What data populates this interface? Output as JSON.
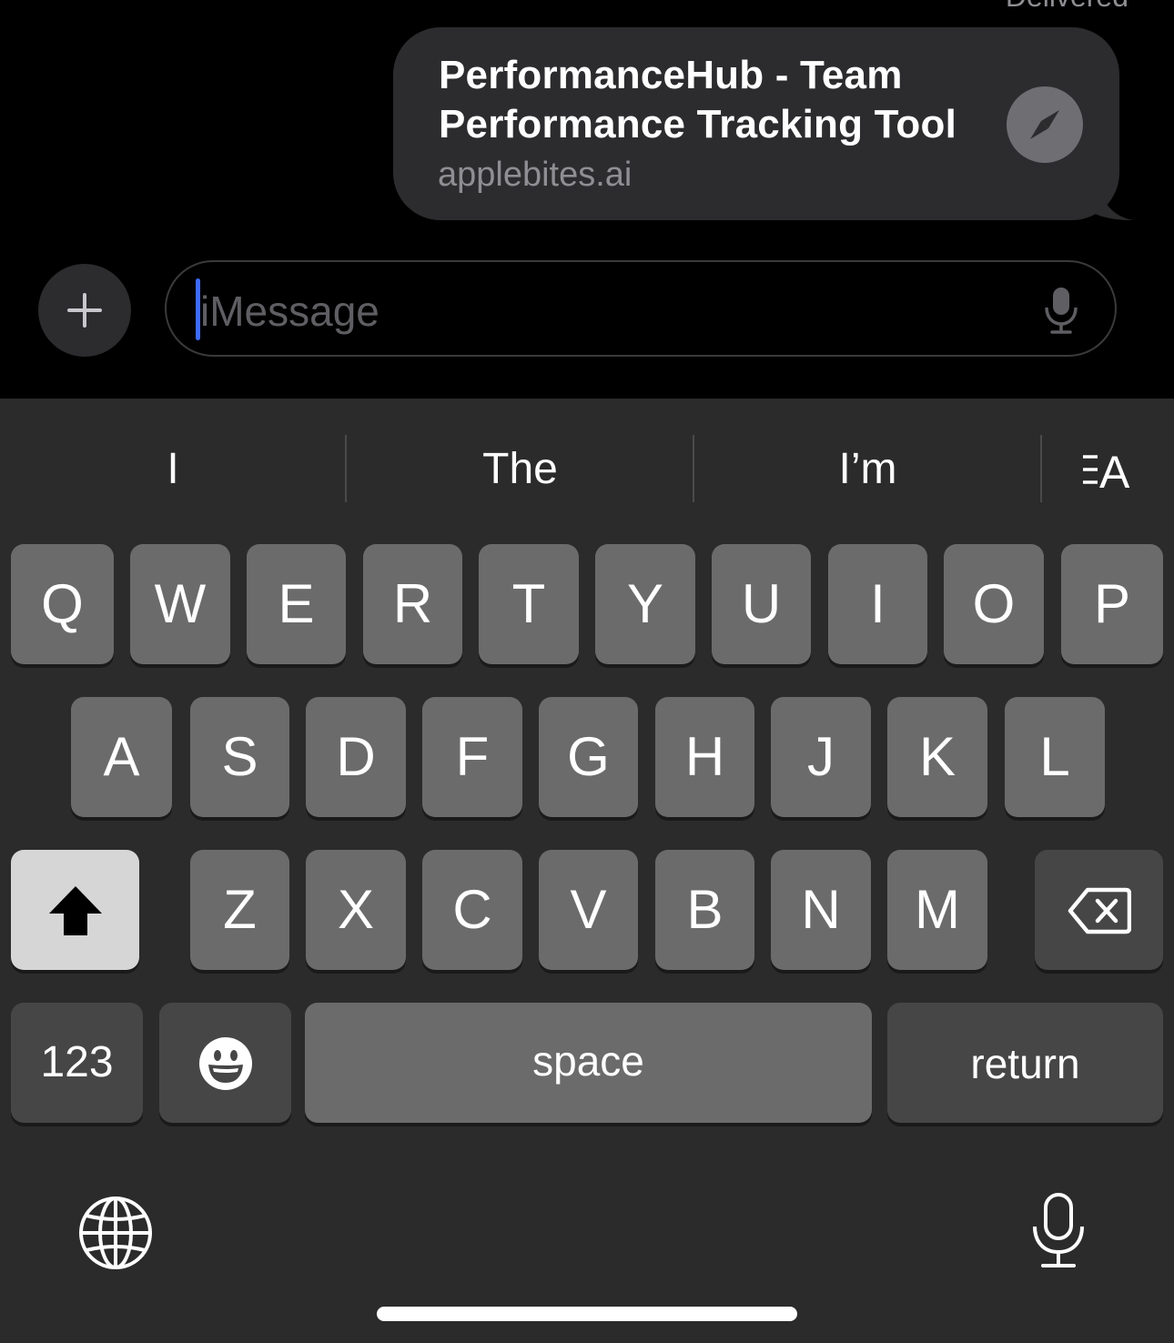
{
  "conversation": {
    "status_text": "Delivered",
    "link_preview": {
      "title": "PerformanceHub - Team Performance Tracking Tool",
      "domain": "applebites.ai",
      "icon": "compass-icon"
    }
  },
  "compose": {
    "add_button_icon": "plus-icon",
    "placeholder": "iMessage",
    "dictation_icon": "microphone-icon"
  },
  "keyboard": {
    "suggestions": [
      "I",
      "The",
      "I’m"
    ],
    "format_icon": "text-format-icon",
    "row1": [
      "Q",
      "W",
      "E",
      "R",
      "T",
      "Y",
      "U",
      "I",
      "O",
      "P"
    ],
    "row2": [
      "A",
      "S",
      "D",
      "F",
      "G",
      "H",
      "J",
      "K",
      "L"
    ],
    "row3": [
      "Z",
      "X",
      "C",
      "V",
      "B",
      "N",
      "M"
    ],
    "shift_icon": "shift-icon",
    "delete_icon": "delete-backward-icon",
    "numbers_label": "123",
    "emoji_icon": "emoji-icon",
    "space_label": "space",
    "return_label": "return",
    "globe_icon": "globe-icon",
    "dictation_icon": "microphone-icon"
  },
  "colors": {
    "bubble": "#2c2c2e",
    "caret": "#3d6bff",
    "keyboard_bg": "#2b2b2b",
    "key": "#6b6b6b",
    "key_dark": "#464646"
  }
}
